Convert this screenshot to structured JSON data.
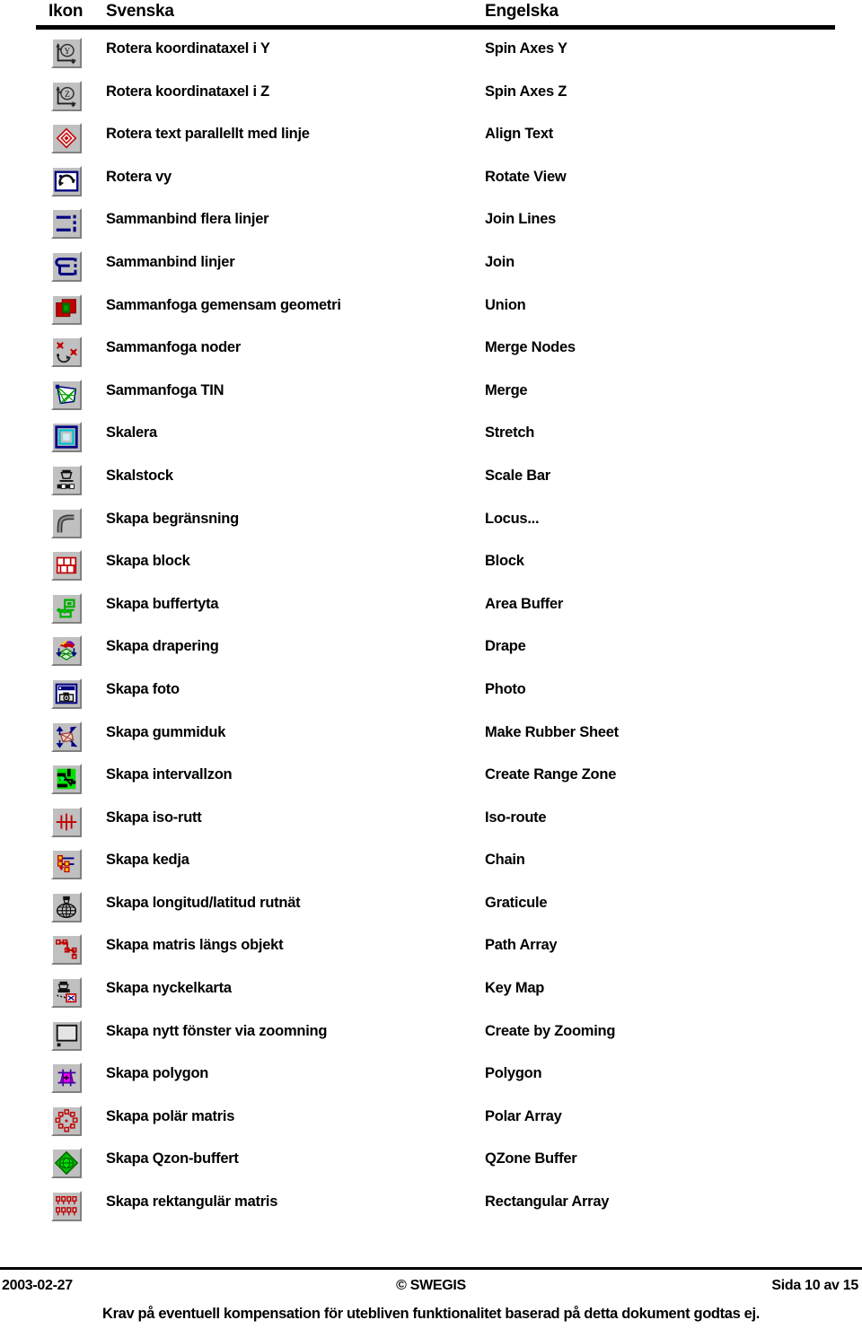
{
  "header": {
    "col_icon": "Ikon",
    "col_swedish": "Svenska",
    "col_english": "Engelska"
  },
  "rows": [
    {
      "icon": "spin-axes-y-icon",
      "swedish": "Rotera koordinataxel i Y",
      "english": "Spin Axes Y"
    },
    {
      "icon": "spin-axes-z-icon",
      "swedish": "Rotera koordinataxel i Z",
      "english": "Spin Axes Z"
    },
    {
      "icon": "align-text-icon",
      "swedish": "Rotera text parallellt med linje",
      "english": "Align Text"
    },
    {
      "icon": "rotate-view-icon",
      "swedish": "Rotera vy",
      "english": "Rotate View"
    },
    {
      "icon": "join-lines-icon",
      "swedish": "Sammanbind flera linjer",
      "english": "Join Lines"
    },
    {
      "icon": "join-icon",
      "swedish": "Sammanbind linjer",
      "english": "Join"
    },
    {
      "icon": "union-icon",
      "swedish": "Sammanfoga gemensam geometri",
      "english": "Union"
    },
    {
      "icon": "merge-nodes-icon",
      "swedish": "Sammanfoga noder",
      "english": "Merge Nodes"
    },
    {
      "icon": "merge-tin-icon",
      "swedish": "Sammanfoga TIN",
      "english": "Merge"
    },
    {
      "icon": "stretch-icon",
      "swedish": "Skalera",
      "english": "Stretch"
    },
    {
      "icon": "scale-bar-icon",
      "swedish": "Skalstock",
      "english": "Scale Bar"
    },
    {
      "icon": "locus-icon",
      "swedish": "Skapa begränsning",
      "english": "Locus..."
    },
    {
      "icon": "block-icon",
      "swedish": "Skapa block",
      "english": "Block"
    },
    {
      "icon": "area-buffer-icon",
      "swedish": "Skapa buffertyta",
      "english": "Area Buffer"
    },
    {
      "icon": "drape-icon",
      "swedish": "Skapa drapering",
      "english": "Drape"
    },
    {
      "icon": "photo-icon",
      "swedish": "Skapa foto",
      "english": "Photo"
    },
    {
      "icon": "rubber-sheet-icon",
      "swedish": "Skapa gummiduk",
      "english": "Make Rubber Sheet"
    },
    {
      "icon": "range-zone-icon",
      "swedish": "Skapa intervallzon",
      "english": "Create Range Zone"
    },
    {
      "icon": "iso-route-icon",
      "swedish": "Skapa iso-rutt",
      "english": "Iso-route"
    },
    {
      "icon": "chain-icon",
      "swedish": "Skapa kedja",
      "english": "Chain"
    },
    {
      "icon": "graticule-icon",
      "swedish": "Skapa longitud/latitud rutnät",
      "english": "Graticule"
    },
    {
      "icon": "path-array-icon",
      "swedish": "Skapa matris längs objekt",
      "english": "Path Array"
    },
    {
      "icon": "key-map-icon",
      "swedish": "Skapa nyckelkarta",
      "english": "Key Map"
    },
    {
      "icon": "create-by-zooming-icon",
      "swedish": "Skapa nytt fönster via zoomning",
      "english": "Create by Zooming"
    },
    {
      "icon": "polygon-icon",
      "swedish": "Skapa polygon",
      "english": "Polygon"
    },
    {
      "icon": "polar-array-icon",
      "swedish": "Skapa polär matris",
      "english": "Polar Array"
    },
    {
      "icon": "qzone-buffer-icon",
      "swedish": "Skapa Qzon-buffert",
      "english": "QZone Buffer"
    },
    {
      "icon": "rectangular-array-icon",
      "swedish": "Skapa rektangulär matris",
      "english": "Rectangular Array"
    }
  ],
  "footer": {
    "date": "2003-02-27",
    "copyright": "© SWEGIS",
    "page": "Sida 10 av 15",
    "disclaimer": "Krav på eventuell kompensation för utebliven funktionalitet baserad på detta dokument godtas ej."
  },
  "colors": {
    "button_face": "#c0c0c0",
    "button_highlight": "#ffffff",
    "button_shadow": "#808080",
    "navy": "#000080",
    "red": "#c00000",
    "green": "#00b000",
    "dark_green": "#006000",
    "magenta": "#ff00ff",
    "cyan": "#00c0d0",
    "text": "#000000"
  }
}
